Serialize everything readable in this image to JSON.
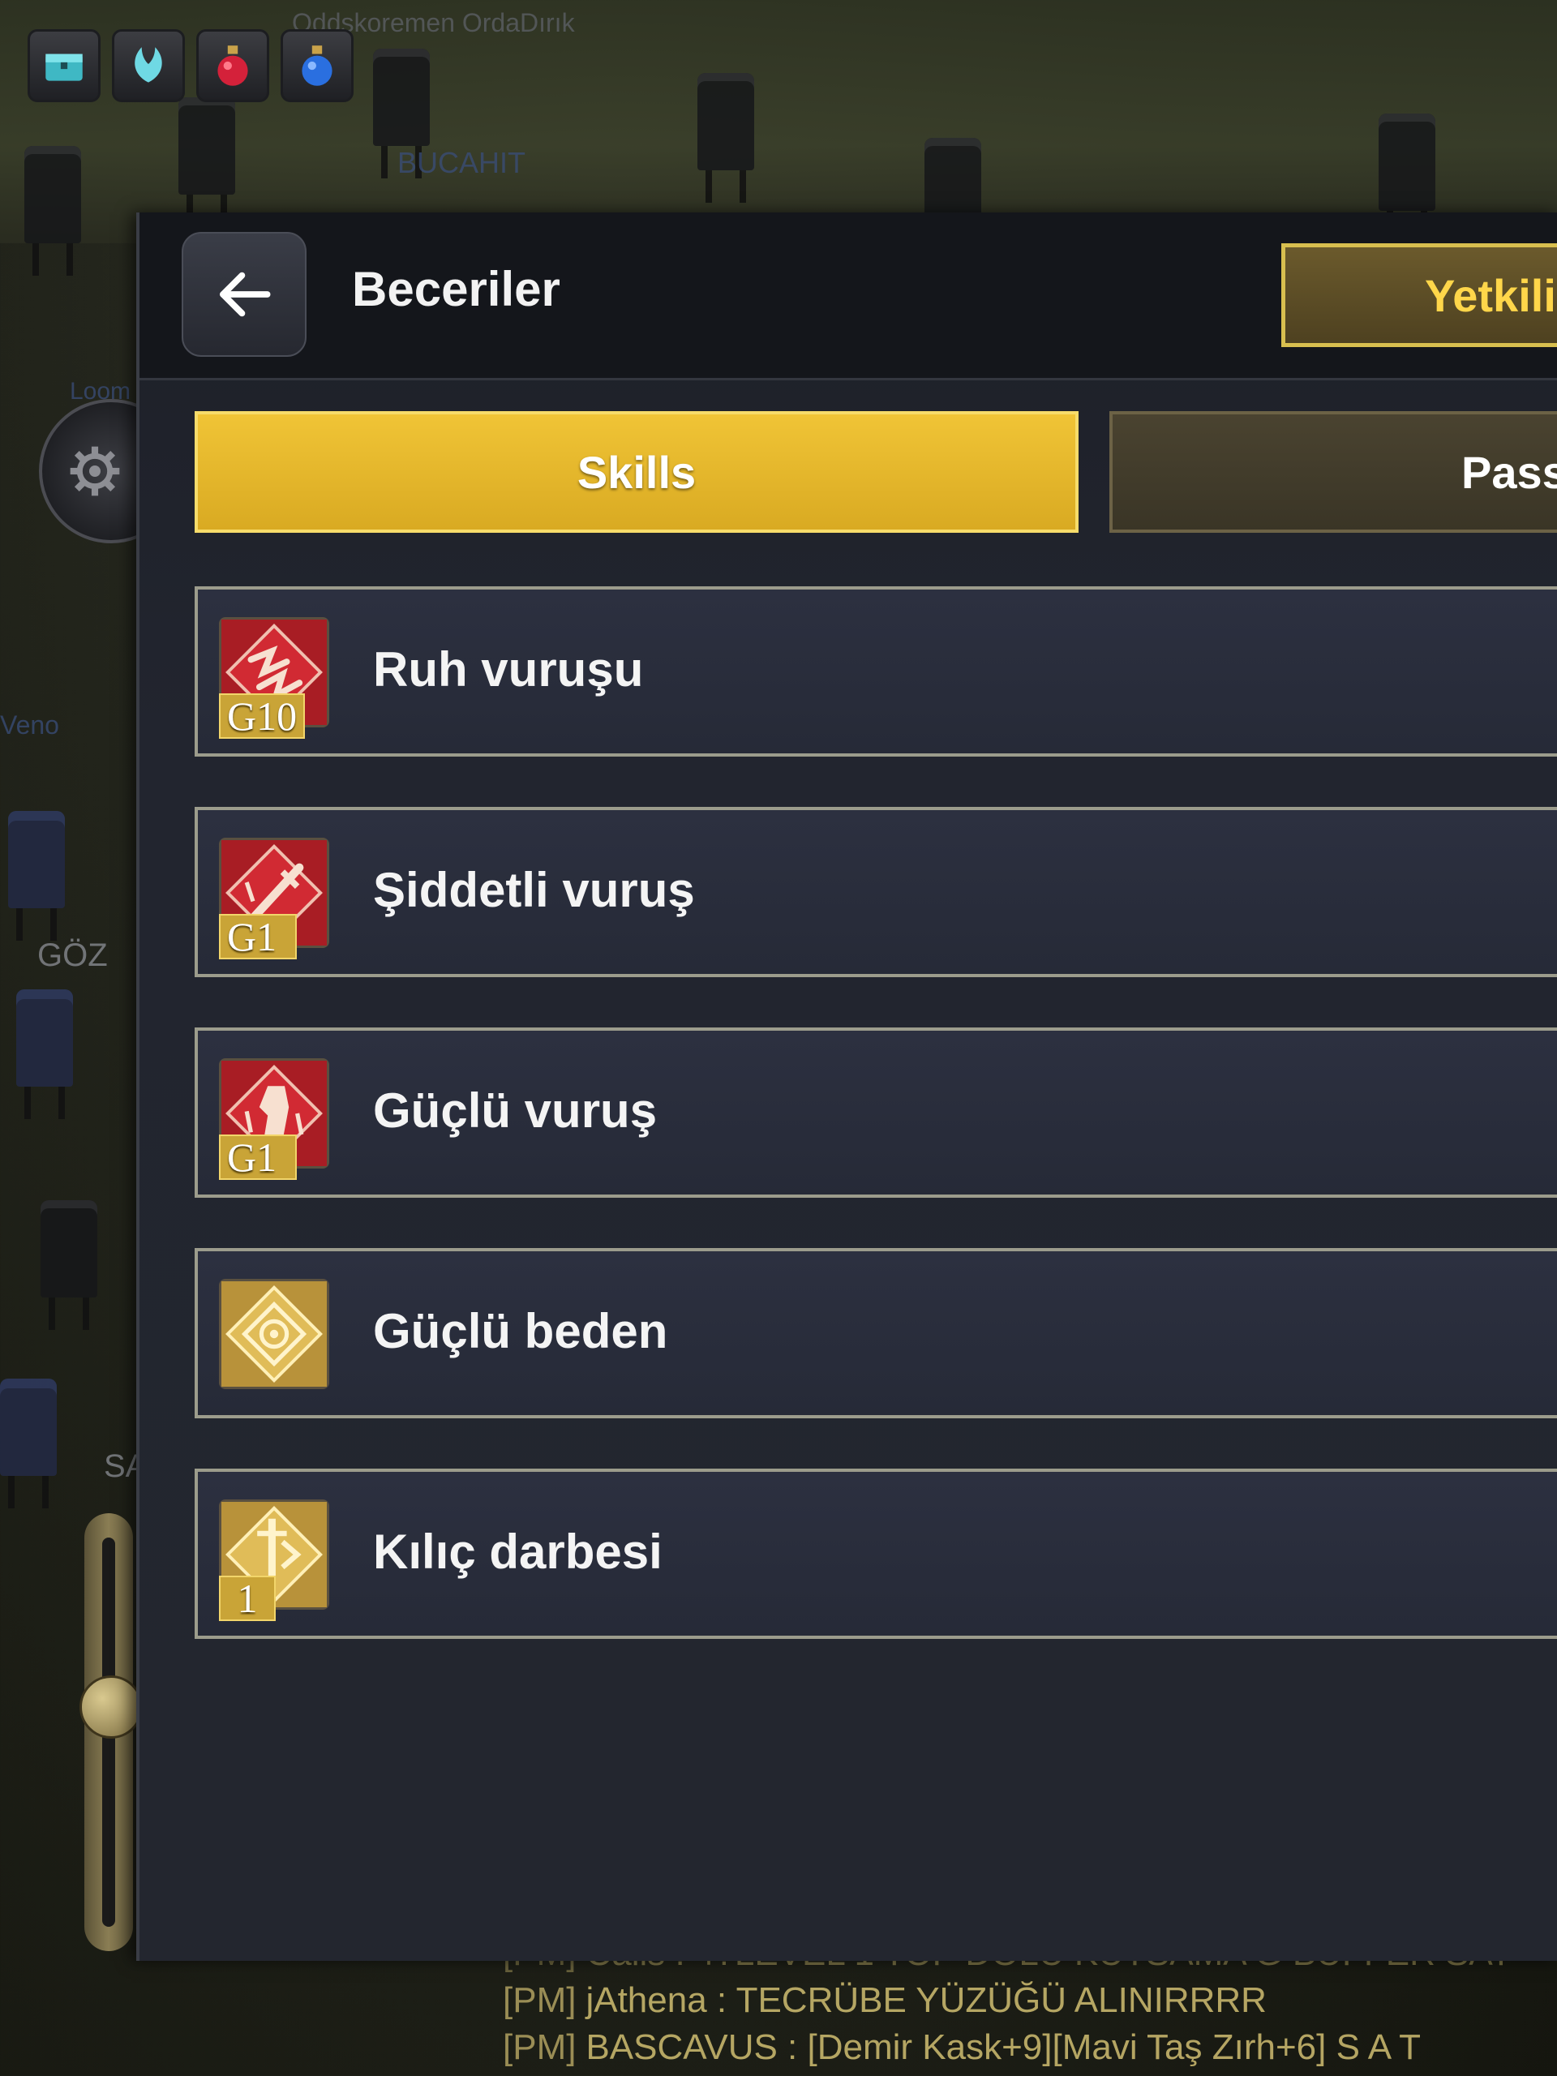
{
  "world": {
    "labels": {
      "top_faded": "Oddşkoremen OrdaDırık",
      "bucahit": "BUCAHIT",
      "loom": "Loom",
      "veno": "Veno",
      "goz": "GÖZ",
      "sa": "SA"
    },
    "item_slots": [
      {
        "icon": "chest-icon",
        "color": "#3fb8c4"
      },
      {
        "icon": "wing-icon",
        "color": "#6fd9e4"
      },
      {
        "icon": "red-potion-icon",
        "color": "#d4213a"
      },
      {
        "icon": "blue-potion-icon",
        "color": "#2a6fe0"
      }
    ]
  },
  "panel": {
    "title": "Beceriler",
    "back_icon": "arrow-left-icon",
    "authorized_button": "Yetkili",
    "tabs": {
      "skills": "Skills",
      "passive": "Pass"
    },
    "skills": [
      {
        "name": "Ruh vuruşu",
        "grade": "G10",
        "icon": "spirit-strike-icon",
        "icon_color": "#c8232b"
      },
      {
        "name": "Şiddetli vuruş",
        "grade": "G1",
        "icon": "severe-strike-icon",
        "icon_color": "#c8232b"
      },
      {
        "name": "Güçlü vuruş",
        "grade": "G1",
        "icon": "strong-strike-icon",
        "icon_color": "#c8232b"
      },
      {
        "name": "Güçlü beden",
        "grade": "",
        "icon": "strong-body-icon",
        "icon_color": "#d9b24a"
      },
      {
        "name": "Kılıç darbesi",
        "grade": "1",
        "icon": "sword-blow-icon",
        "icon_color": "#d9b24a"
      }
    ]
  },
  "chat": {
    "lines": [
      {
        "tag": "[PM]",
        "text": "Calls : 4?LEVEL 1 TOP DOLU KUTSAMA G BÜFFER SAT"
      },
      {
        "tag": "[PM]",
        "text": "jAthena : TECRÜBE YÜZÜĞÜ ALINIRRRR"
      },
      {
        "tag": "[PM]",
        "text": "BASCAVUS : [Demir Kask+9][Mavi Taş Zırh+6] S A T"
      }
    ]
  },
  "colors": {
    "accent_gold": "#f0c436",
    "gold_text": "#ffd64a",
    "panel_bg": "#23262f"
  }
}
